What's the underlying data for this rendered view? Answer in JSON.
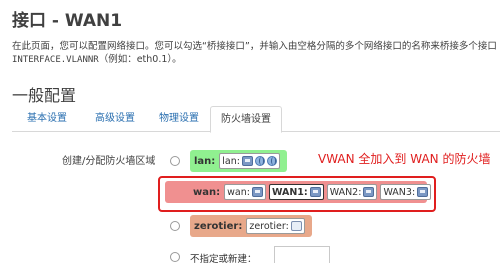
{
  "page": {
    "title": "接口 - WAN1",
    "description_line1": "在此页面，您可以配置网络接口。您可以勾选“桥接接口”，并输入由空格分隔的多个网络接口的名称来桥接多个接口",
    "description_line2_mono": "INTERFACE.VLANNR",
    "description_line2_rest": "（例如：eth0.1）。"
  },
  "section": {
    "title": "一般配置"
  },
  "tabs": [
    {
      "label": "基本设置",
      "active": false
    },
    {
      "label": "高级设置",
      "active": false
    },
    {
      "label": "物理设置",
      "active": false
    },
    {
      "label": "防火墙设置",
      "active": true
    }
  ],
  "firewall": {
    "field_label": "创建/分配防火墙区域",
    "zones": [
      {
        "name": "lan:",
        "color": "#90f090",
        "selected": false,
        "chips": [
          {
            "label": "lan:",
            "icons": [
              "net-icon",
              "globe-icon",
              "globe-icon"
            ]
          }
        ]
      },
      {
        "name": "wan:",
        "color": "#f09090",
        "selected": true,
        "chips": [
          {
            "label": "wan:",
            "icons": [
              "net-icon"
            ]
          },
          {
            "label": "WAN1:",
            "icons": [
              "net-icon"
            ],
            "bold": true
          },
          {
            "label": "WAN2:",
            "icons": [
              "net-icon"
            ]
          },
          {
            "label": "WAN3:",
            "icons": [
              "net-icon"
            ]
          }
        ]
      },
      {
        "name": "zerotier:",
        "color": "#e8a88a",
        "selected": false,
        "chips": [
          {
            "label": "zerotier:",
            "icons": [
              "wifi-icon"
            ]
          }
        ]
      }
    ],
    "custom_label": "不指定或新建："
  },
  "annotation": {
    "text": "VWAN 全加入到 WAN 的防火墙",
    "color": "#e01e1e"
  }
}
